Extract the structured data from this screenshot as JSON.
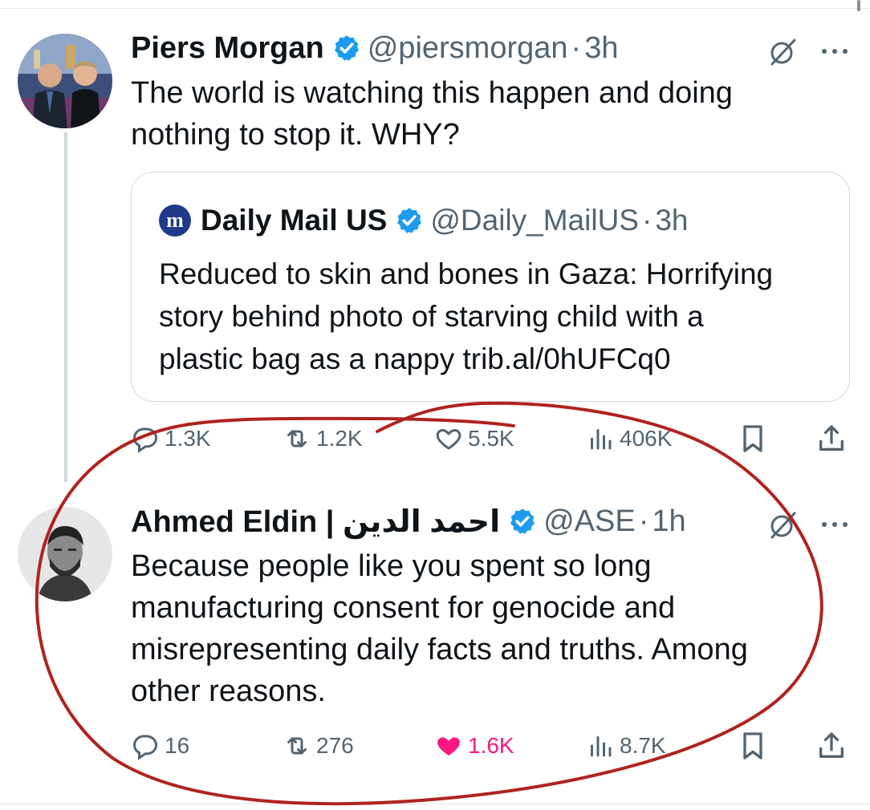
{
  "tweet1": {
    "display_name": "Piers Morgan",
    "handle": "@piersmorgan",
    "separator": "·",
    "time": "3h",
    "text_line1": "The world is watching this happen and doing",
    "text_line2": "nothing to stop it. WHY?",
    "quote": {
      "logo_text": "m",
      "display_name": "Daily Mail US",
      "handle": "@Daily_MailUS",
      "separator": "·",
      "time": "3h",
      "line1": "Reduced to skin and bones in Gaza: Horrifying",
      "line2": "story behind photo of starving child with a",
      "line3": "plastic bag as a nappy trib.al/0hUFCq0"
    },
    "stats": {
      "replies": "1.3K",
      "reposts": "1.2K",
      "likes": "5.5K",
      "views": "406K"
    }
  },
  "tweet2": {
    "display_name": "Ahmed Eldin | احمد الدين",
    "handle": "@ASE",
    "separator": "·",
    "time": "1h",
    "line1": "Because people like you spent so long",
    "line2": "manufacturing consent for genocide and",
    "line3": "misrepresenting daily facts and truths. Among",
    "line4": "other reasons.",
    "stats": {
      "replies": "16",
      "reposts": "276",
      "likes": "1.6K",
      "views": "8.7K",
      "liked": true
    }
  },
  "colors": {
    "verified": "#1d9bf0",
    "secondary_text": "#536471",
    "like_active": "#f91880",
    "annotation": "#b0231f"
  }
}
